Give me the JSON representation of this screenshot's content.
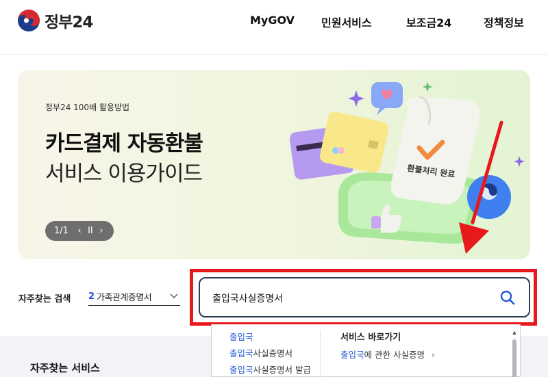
{
  "header": {
    "logo_text": "정부24",
    "nav": [
      "MyGOV",
      "민원서비스",
      "보조금24",
      "정책정보"
    ]
  },
  "banner": {
    "subtitle": "정부24 100배 활용방법",
    "title_line1": "카드결제 자동환불",
    "title_line2": "서비스 이용가이드",
    "pager": {
      "count": "1/1",
      "prev_icon": "chevron-left-icon",
      "pause_icon": "pause-icon",
      "next_icon": "chevron-right-icon"
    },
    "receipt_text": "환불처리 완료"
  },
  "search": {
    "frequent_label": "자주찾는 검색",
    "frequent_rank": "2",
    "frequent_term": "가족관계증명서",
    "value": "출입국사실증명서"
  },
  "suggestions": {
    "items": [
      {
        "highlight": "출입국",
        "rest": ""
      },
      {
        "highlight": "출입국",
        "rest": "사실증명서"
      },
      {
        "highlight": "출입국",
        "rest": "사실증명서 발급"
      }
    ],
    "shortcut_heading": "서비스 바로가기",
    "shortcut_link": {
      "highlight": "출입국",
      "rest": "에 관한 사실증명",
      "chevron": "›"
    }
  },
  "frequent_services_label": "자주찾는 서비스",
  "colors": {
    "accent_blue": "#1c54d6",
    "highlight_red": "#e8191d",
    "search_border": "#2b3a55"
  }
}
